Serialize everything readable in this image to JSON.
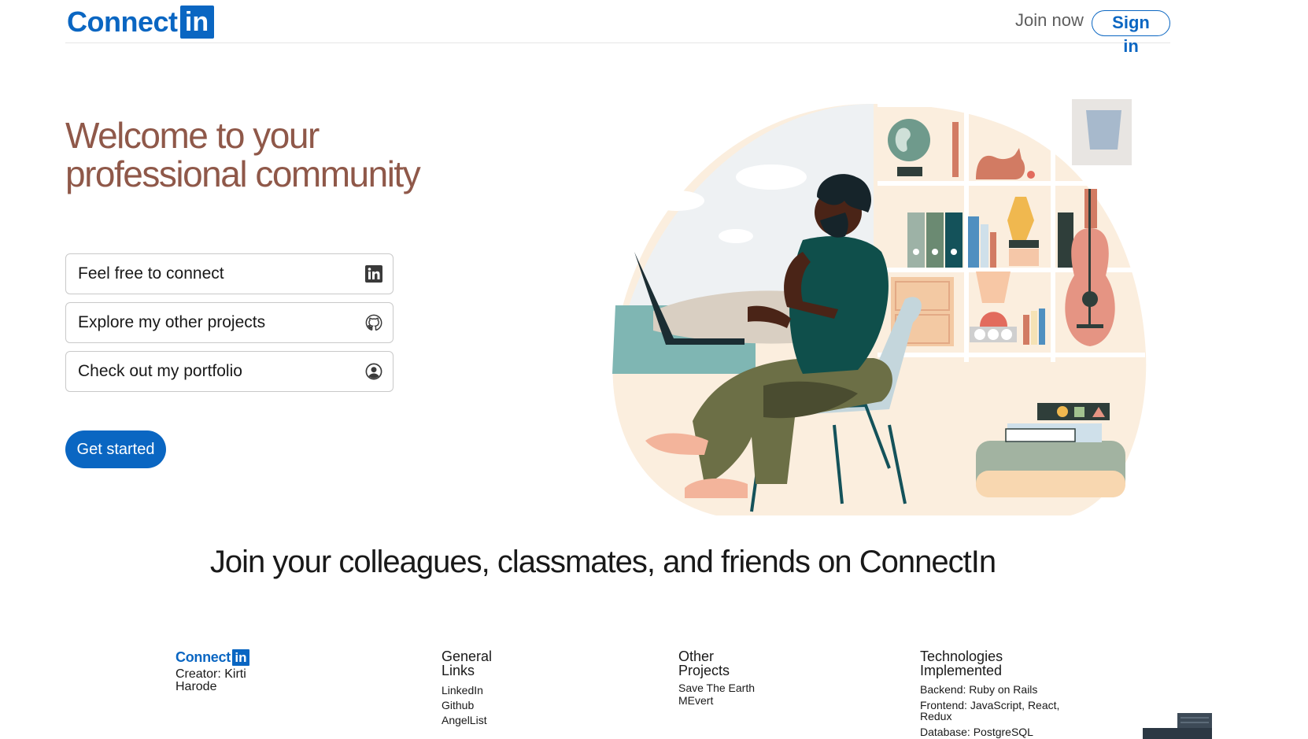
{
  "header": {
    "logo_text": "Connect",
    "logo_box": "in",
    "join_now": "Join now",
    "sign_in": "Sign in"
  },
  "hero": {
    "title": "Welcome to your professional community",
    "links": [
      {
        "label": "Feel free to connect",
        "icon": "linkedin-icon"
      },
      {
        "label": "Explore my other projects",
        "icon": "github-icon"
      },
      {
        "label": "Check out my portfolio",
        "icon": "user-circle-icon"
      }
    ],
    "cta": "Get started"
  },
  "banner": {
    "text": "Join your colleagues, classmates, and friends on ConnectIn"
  },
  "footer": {
    "logo_text": "Connect",
    "logo_box": "in",
    "creator": "Creator: Kirti Harode",
    "general_links": {
      "heading": "General Links",
      "items": [
        "LinkedIn",
        "Github",
        "AngelList"
      ]
    },
    "other_projects": {
      "heading": "Other Projects",
      "items": [
        "Save The Earth",
        "MEvert"
      ]
    },
    "technologies": {
      "heading": "Technologies Implemented",
      "items": [
        "Backend: Ruby on Rails",
        "Frontend: JavaScript, React, Redux",
        "Database: PostgreSQL"
      ]
    }
  },
  "colors": {
    "brand": "#0a66c2",
    "hero_title": "#8f5849"
  }
}
